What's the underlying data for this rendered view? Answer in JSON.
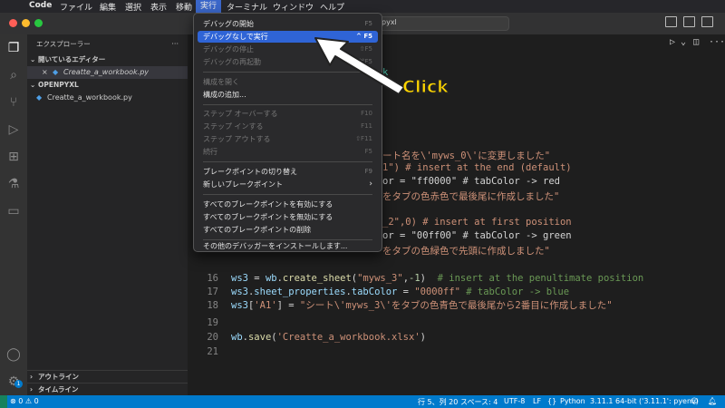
{
  "menubar": {
    "apple": "",
    "app": "Code",
    "items": [
      "ファイル",
      "編集",
      "選択",
      "表示",
      "移動",
      "実行",
      "ターミナル",
      "ウィンドウ",
      "ヘルプ"
    ],
    "selected": "実行"
  },
  "titlebar": {
    "search_text": "pyxl"
  },
  "sidebar": {
    "title": "エクスプローラー",
    "more": "···",
    "open_editors": "開いているエディター",
    "open_file": "Creatte_a_workbook.py",
    "project": "OPENPYXL",
    "file": "Creatte_a_workbook.py",
    "outline": "アウトライン",
    "timeline": "タイムライン"
  },
  "run_menu": {
    "items": [
      {
        "label": "デバッグの開始",
        "shortcut": "F5"
      },
      {
        "label": "デバッグなしで実行",
        "shortcut": "^ F5"
      },
      {
        "label": "デバッグの停止",
        "shortcut": "⇧F5"
      },
      {
        "label": "デバッグの再起動",
        "shortcut": "⇧⌘F5"
      },
      {
        "label": "構成を開く",
        "shortcut": ""
      },
      {
        "label": "構成の追加...",
        "shortcut": ""
      },
      {
        "label": "ステップ オーバーする",
        "shortcut": "F10"
      },
      {
        "label": "ステップ インする",
        "shortcut": "F11"
      },
      {
        "label": "ステップ アウトする",
        "shortcut": "⇧F11"
      },
      {
        "label": "続行",
        "shortcut": "F5"
      },
      {
        "label": "ブレークポイントの切り替え",
        "shortcut": "F9"
      },
      {
        "label": "新しいブレークポイント",
        "shortcut": "›"
      },
      {
        "label": "すべてのブレークポイントを有効にする",
        "shortcut": ""
      },
      {
        "label": "すべてのブレークポイントを無効にする",
        "shortcut": ""
      },
      {
        "label": "すべてのブレークポイントの削除",
        "shortcut": ""
      },
      {
        "label": "その他のデバッガーをインストールします...",
        "shortcut": ""
      }
    ]
  },
  "editor": {
    "peek": [
      "k",
      "ート名を\\'myws_0\\'に変更しました\"",
      "1\") # insert at the end (default)",
      "or = \"ff0000\" # tabColor -> red",
      "をタブの色赤色で最後尾に作成しました\"",
      "_2\",0) # insert at first position",
      "or = \"00ff00\" # tabColor -> green",
      "をタブの色緑色で先頭に作成しました\""
    ],
    "lines": [
      {
        "n": "16",
        "parts": []
      },
      {
        "n": "16",
        "parts": [
          [
            "c-def",
            "ws3"
          ],
          [
            "c-op",
            " = "
          ],
          [
            "c-def",
            "wb"
          ],
          [
            "c-op",
            "."
          ],
          [
            "c-fn",
            "create_sheet"
          ],
          [
            "c-op",
            "("
          ],
          [
            "c-str",
            "\"myws_3\""
          ],
          [
            "c-op",
            ","
          ],
          [
            "c-num",
            "-1"
          ],
          [
            "c-op",
            ")  "
          ],
          [
            "c-com",
            "# insert at the penultimate position"
          ]
        ]
      },
      {
        "n": "17",
        "parts": [
          [
            "c-def",
            "ws3"
          ],
          [
            "c-op",
            "."
          ],
          [
            "c-def",
            "sheet_properties"
          ],
          [
            "c-op",
            "."
          ],
          [
            "c-def",
            "tabColor"
          ],
          [
            "c-op",
            " = "
          ],
          [
            "c-str",
            "\"0000ff\""
          ],
          [
            "c-op",
            " "
          ],
          [
            "c-com",
            "# tabColor -> blue"
          ]
        ]
      },
      {
        "n": "18",
        "parts": [
          [
            "c-def",
            "ws3"
          ],
          [
            "c-op",
            "["
          ],
          [
            "c-str",
            "'A1'"
          ],
          [
            "c-op",
            "] = "
          ],
          [
            "c-str",
            "\"シート\\'myws_3\\'をタブの色青色で最後尾から2番目に作成しました\""
          ]
        ]
      },
      {
        "n": "19",
        "parts": []
      },
      {
        "n": "20",
        "parts": [
          [
            "c-def",
            "wb"
          ],
          [
            "c-op",
            "."
          ],
          [
            "c-fn",
            "save"
          ],
          [
            "c-op",
            "("
          ],
          [
            "c-str",
            "'Creatte_a_workbook.xlsx'"
          ],
          [
            "c-op",
            ")"
          ]
        ]
      },
      {
        "n": "21",
        "parts": []
      }
    ]
  },
  "status": {
    "errors": "⊗ 0 ⚠ 0",
    "position": "行 5、列 20",
    "spaces": "スペース: 4",
    "encoding": "UTF-8",
    "eol": "LF",
    "language": "Python",
    "interpreter": "3.11.1 64-bit ('3.11.1': pyenv)"
  },
  "callout": {
    "text": "Click"
  },
  "colors": {
    "highlight": "#2f64d6",
    "statusbar": "#007acc",
    "callout": "#ffd600"
  }
}
